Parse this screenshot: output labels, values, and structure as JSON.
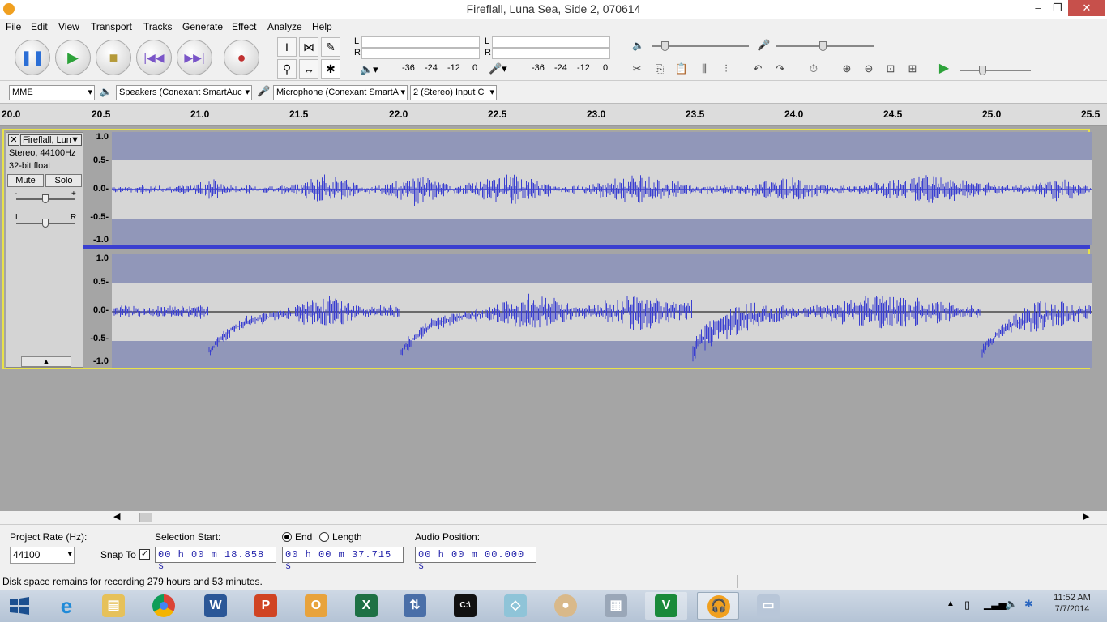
{
  "window": {
    "title": "Fireflall, Luna Sea, Side 2, 070614"
  },
  "menu": [
    "File",
    "Edit",
    "View",
    "Transport",
    "Tracks",
    "Generate",
    "Effect",
    "Analyze",
    "Help"
  ],
  "meters": {
    "play_ticks": [
      "-36",
      "-24",
      "-12",
      "0"
    ],
    "rec_ticks": [
      "-36",
      "-24",
      "-12",
      "0"
    ],
    "l": "L",
    "r": "R"
  },
  "devices": {
    "host": "MME",
    "output": "Speakers (Conexant SmartAuc",
    "input": "Microphone (Conexant SmartA",
    "channels": "2 (Stereo) Input C"
  },
  "ruler": [
    "20.0",
    "20.5",
    "21.0",
    "21.5",
    "22.0",
    "22.5",
    "23.0",
    "23.5",
    "24.0",
    "24.5",
    "25.0",
    "25.5"
  ],
  "track": {
    "name": "Fireflall, Lun",
    "info1": "Stereo, 44100Hz",
    "info2": "32-bit float",
    "mute": "Mute",
    "solo": "Solo",
    "gain_minus": "-",
    "gain_plus": "+",
    "pan_l": "L",
    "pan_r": "R",
    "y_labels": [
      "1.0",
      "0.5-",
      "0.0-",
      "-0.5-",
      "-1.0"
    ]
  },
  "selection": {
    "project_rate_label": "Project Rate (Hz):",
    "project_rate": "44100",
    "snap_label": "Snap To",
    "sel_start_label": "Selection Start:",
    "end_label": "End",
    "length_label": "Length",
    "audio_pos_label": "Audio Position:",
    "start": "00 h 00 m 18.858 s",
    "end": "00 h 00 m 37.715 s",
    "audio_pos": "00 h 00 m 00.000 s"
  },
  "status": "Disk space remains for recording 279 hours and 53 minutes.",
  "clock": {
    "time": "11:52 AM",
    "date": "7/7/2014"
  },
  "colors": {
    "wave": "#3a3fd0",
    "selection_border": "#e8e24a"
  }
}
